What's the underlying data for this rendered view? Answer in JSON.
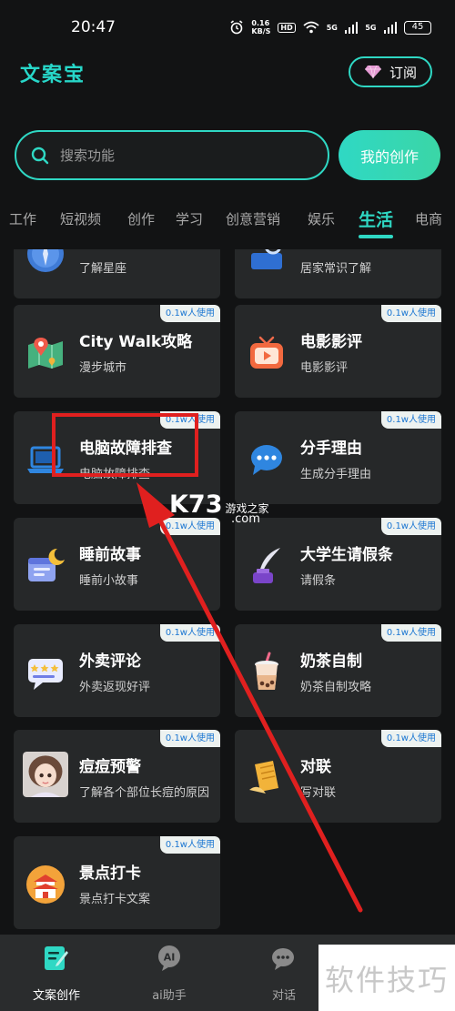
{
  "status_bar": {
    "time": "20:47",
    "net_speed_value": "0.16",
    "net_speed_unit": "KB/S",
    "hd_label": "HD",
    "signal1_label": "5G",
    "signal2_label": "5G",
    "battery": "45"
  },
  "header": {
    "logo": "文案宝",
    "subscribe_label": "订阅"
  },
  "search": {
    "placeholder": "搜索功能",
    "my_works_label": "我的创作"
  },
  "tabs": [
    "工作",
    "短视频",
    "创作",
    "学习",
    "创意营销",
    "娱乐",
    "生活",
    "电商"
  ],
  "active_tab": "生活",
  "cards": [
    {
      "badge": "",
      "title": "",
      "subtitle": "了解星座",
      "icon": "compass-icon"
    },
    {
      "badge": "",
      "title": "",
      "subtitle": "居家常识了解",
      "icon": "home-knowledge-icon"
    },
    {
      "badge": "0.1w人使用",
      "title": "City Walk攻略",
      "subtitle": "漫步城市",
      "icon": "map-pin-icon"
    },
    {
      "badge": "0.1w人使用",
      "title": "电影影评",
      "subtitle": "电影影评",
      "icon": "tv-play-icon"
    },
    {
      "badge": "0.1w人使用",
      "title": "电脑故障排查",
      "subtitle": "电脑故障排查",
      "icon": "laptop-icon"
    },
    {
      "badge": "0.1w人使用",
      "title": "分手理由",
      "subtitle": "生成分手理由",
      "icon": "chat-bubble-icon"
    },
    {
      "badge": "0.1w人使用",
      "title": "睡前故事",
      "subtitle": "睡前小故事",
      "icon": "moon-calendar-icon"
    },
    {
      "badge": "0.1w人使用",
      "title": "大学生请假条",
      "subtitle": "请假条",
      "icon": "quill-ink-icon"
    },
    {
      "badge": "0.1w人使用",
      "title": "外卖评论",
      "subtitle": "外卖返现好评",
      "icon": "star-review-icon"
    },
    {
      "badge": "0.1w人使用",
      "title": "奶茶自制",
      "subtitle": "奶茶自制攻略",
      "icon": "milk-tea-icon"
    },
    {
      "badge": "0.1w人使用",
      "title": "痘痘预警",
      "subtitle": "了解各个部位长痘的原因",
      "icon": "girl-avatar-icon"
    },
    {
      "badge": "0.1w人使用",
      "title": "对联",
      "subtitle": "写对联",
      "icon": "couplet-icon"
    },
    {
      "badge": "0.1w人使用",
      "title": "景点打卡",
      "subtitle": "景点打卡文案",
      "icon": "temple-icon"
    }
  ],
  "watermark": {
    "k73": "K73",
    "k73_sub": "游戏之家",
    "k73_com": ".com",
    "tips": "软件技巧"
  },
  "bottom_nav": [
    {
      "label": "文案创作",
      "icon": "edit-doc-icon",
      "active": true
    },
    {
      "label": "ai助手",
      "icon": "ai-assistant-icon",
      "active": false
    },
    {
      "label": "对话",
      "icon": "chat-icon",
      "active": false
    }
  ],
  "colors": {
    "accent": "#2fd8c4",
    "background": "#121314",
    "card": "#262829",
    "badge_text": "#1b76d2",
    "annotation": "#e0201f"
  }
}
